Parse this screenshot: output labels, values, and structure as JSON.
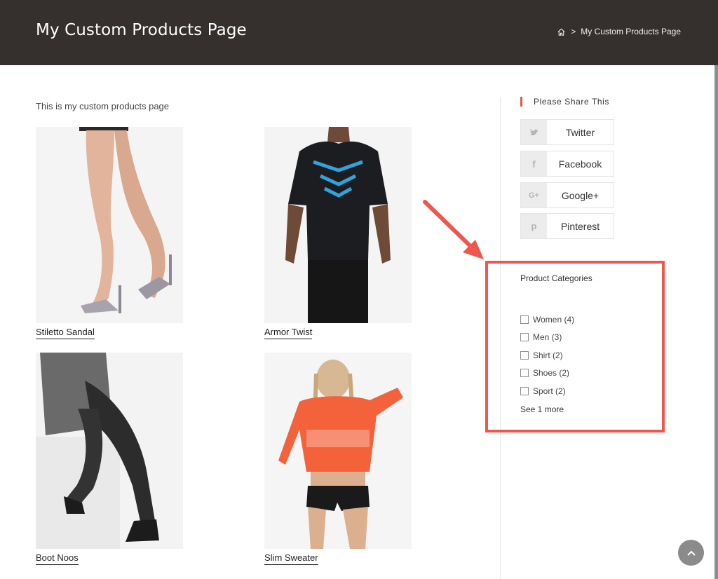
{
  "header": {
    "title": "My Custom Products Page",
    "breadcrumb": {
      "separator": ">",
      "current": "My Custom Products Page"
    }
  },
  "main": {
    "intro": "This is my custom products page",
    "products": [
      {
        "name": "Stiletto Sandal"
      },
      {
        "name": "Armor Twist"
      },
      {
        "name": "Boot Noos"
      },
      {
        "name": "Slim Sweater"
      }
    ]
  },
  "sidebar": {
    "share_title": "Please Share This",
    "share_buttons": [
      {
        "label": "Twitter",
        "icon": "twitter-icon"
      },
      {
        "label": "Facebook",
        "icon": "facebook-icon"
      },
      {
        "label": "Google+",
        "icon": "google-plus-icon"
      },
      {
        "label": "Pinterest",
        "icon": "pinterest-icon"
      }
    ],
    "categories": {
      "title": "Product Categories",
      "items": [
        {
          "label": "Women (4)"
        },
        {
          "label": "Men (3)"
        },
        {
          "label": "Shirt (2)"
        },
        {
          "label": "Shoes (2)"
        },
        {
          "label": "Sport (2)"
        }
      ],
      "see_more": "See 1 more"
    }
  },
  "colors": {
    "header_bg": "#352f2e",
    "accent": "#f0574c"
  }
}
